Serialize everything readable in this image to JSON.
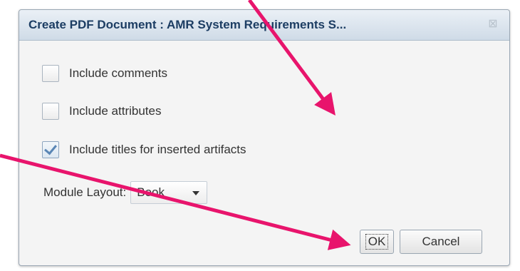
{
  "dialog": {
    "title": "Create PDF Document : AMR System Requirements S...",
    "close_icon": "close-icon"
  },
  "options": [
    {
      "label": "Include comments",
      "checked": false
    },
    {
      "label": "Include attributes",
      "checked": false
    },
    {
      "label": "Include titles for inserted artifacts",
      "checked": true
    }
  ],
  "layout": {
    "label": "Module Layout:",
    "selected": "Book"
  },
  "buttons": {
    "ok": "OK",
    "cancel": "Cancel"
  },
  "annotation_color": "#e8146c"
}
